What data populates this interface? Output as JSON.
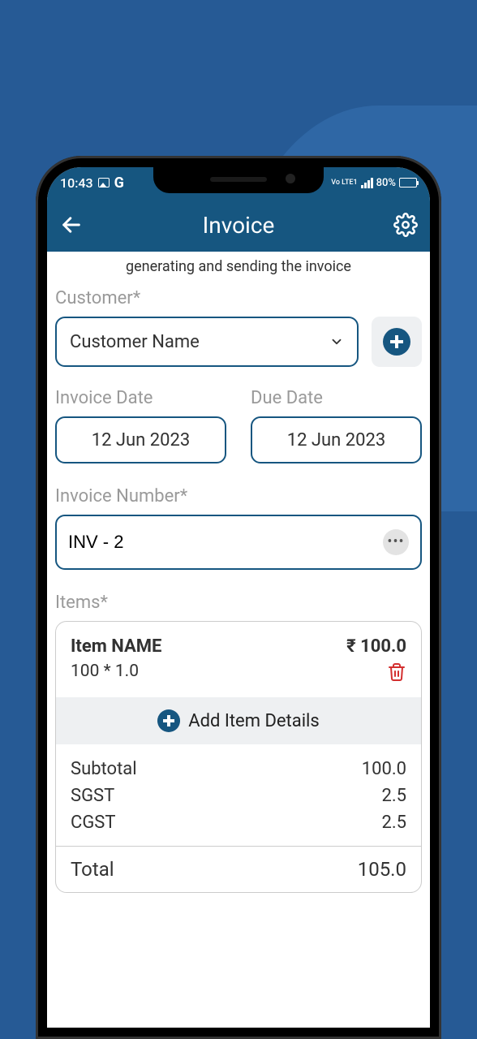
{
  "status": {
    "time": "10:43",
    "g_label": "G",
    "network": "Vo LTE1",
    "battery_pct": "80%"
  },
  "header": {
    "title": "Invoice"
  },
  "hint": "generating and sending the invoice",
  "customer": {
    "label": "Customer*",
    "placeholder": "Customer Name"
  },
  "invoice_date": {
    "label": "Invoice Date",
    "value": "12 Jun 2023"
  },
  "due_date": {
    "label": "Due Date",
    "value": "12 Jun 2023"
  },
  "invoice_number": {
    "label": "Invoice Number*",
    "value": "INV - 2"
  },
  "items": {
    "label": "Items*",
    "rows": [
      {
        "name": "Item NAME",
        "qty": "100 * 1.0",
        "price": "₹ 100.0"
      }
    ],
    "add_label": "Add Item Details"
  },
  "totals": {
    "subtotal_label": "Subtotal",
    "subtotal_value": "100.0",
    "sgst_label": "SGST",
    "sgst_value": "2.5",
    "cgst_label": "CGST",
    "cgst_value": "2.5",
    "total_label": "Total",
    "total_value": "105.0"
  }
}
